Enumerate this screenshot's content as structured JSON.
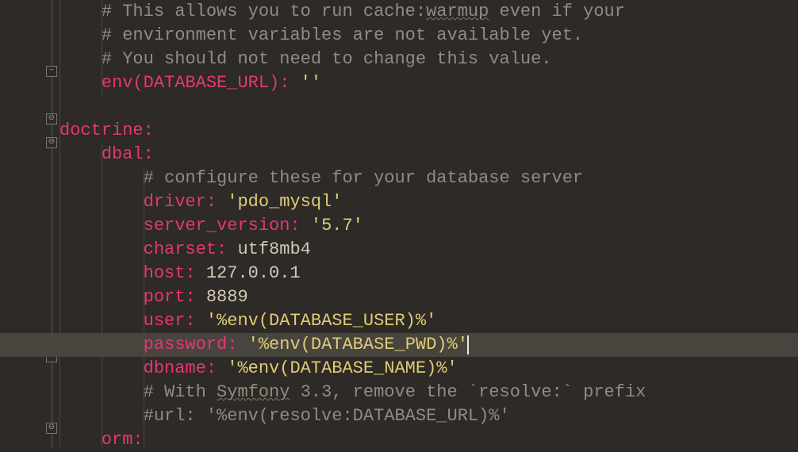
{
  "lines": {
    "l1": {
      "comment_pre": "# This allows you to run cache:",
      "squiggle": "warmup",
      "comment_post": " even if your"
    },
    "l2": "# environment variables are not available yet.",
    "l3": "# You should not need to change this value.",
    "l4": {
      "key": "env(DATABASE_URL):",
      "value": "''"
    },
    "l6": {
      "key": "doctrine:"
    },
    "l7": {
      "key": "dbal:"
    },
    "l8": "# configure these for your database server",
    "l9": {
      "key": "driver:",
      "value": "'pdo_mysql'"
    },
    "l10": {
      "key": "server_version:",
      "value": "'5.7'"
    },
    "l11": {
      "key": "charset:",
      "value": "utf8mb4"
    },
    "l12": {
      "key": "host:",
      "value": "127.0.0.1"
    },
    "l13": {
      "key": "port:",
      "value": "8889"
    },
    "l14": {
      "key": "user:",
      "value": "'%env(DATABASE_USER)%'"
    },
    "l15": {
      "key": "password:",
      "value": "'%env(DATABASE_PWD)%'"
    },
    "l16": {
      "key": "dbname:",
      "value": "'%env(DATABASE_NAME)%'"
    },
    "l17": {
      "comment_pre": "# With ",
      "squiggle": "Symfony",
      "comment_post": " 3.3, remove the `resolve:` prefix"
    },
    "l18": "#url: '%env(resolve:DATABASE_URL)%'",
    "l19": {
      "key": "orm:"
    }
  },
  "fold_markers": {
    "minus": "−",
    "collapse": "⊖"
  }
}
